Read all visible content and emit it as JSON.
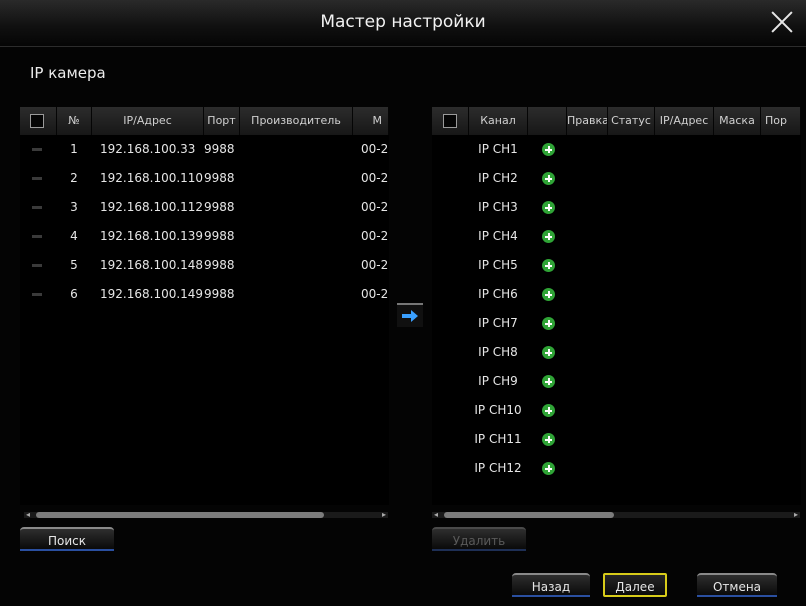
{
  "window": {
    "title": "Мастер настройки"
  },
  "section_title": "IP камера",
  "left_table": {
    "headers": {
      "no": "№",
      "ip": "IP/Адрес",
      "port": "Порт",
      "vendor": "Производитель",
      "mac": "М"
    },
    "rows": [
      {
        "no": "1",
        "ip": "192.168.100.33",
        "port": "9988",
        "mac": "00-2"
      },
      {
        "no": "2",
        "ip": "192.168.100.110",
        "port": "9988",
        "mac": "00-2"
      },
      {
        "no": "3",
        "ip": "192.168.100.112",
        "port": "9988",
        "mac": "00-2"
      },
      {
        "no": "4",
        "ip": "192.168.100.139",
        "port": "9988",
        "mac": "00-2"
      },
      {
        "no": "5",
        "ip": "192.168.100.148",
        "port": "9988",
        "mac": "00-2"
      },
      {
        "no": "6",
        "ip": "192.168.100.149",
        "port": "9988",
        "mac": "00-2"
      }
    ],
    "search_button": "Поиск"
  },
  "right_table": {
    "headers": {
      "channel": "Канал",
      "edit": "Правка",
      "status": "Статус",
      "ip": "IP/Адрес",
      "mask": "Маска",
      "port": "Пор"
    },
    "rows": [
      {
        "channel": "IP CH1",
        "icon": "add-icon"
      },
      {
        "channel": "IP CH2",
        "icon": "add-icon"
      },
      {
        "channel": "IP CH3",
        "icon": "add-icon"
      },
      {
        "channel": "IP CH4",
        "icon": "add-icon"
      },
      {
        "channel": "IP CH5",
        "icon": "add-icon"
      },
      {
        "channel": "IP CH6",
        "icon": "add-icon"
      },
      {
        "channel": "IP CH7",
        "icon": "add-icon"
      },
      {
        "channel": "IP CH8",
        "icon": "add-icon"
      },
      {
        "channel": "IP CH9",
        "icon": "add-icon"
      },
      {
        "channel": "IP CH10",
        "icon": "add-icon"
      },
      {
        "channel": "IP CH11",
        "icon": "add-icon"
      },
      {
        "channel": "IP CH12",
        "icon": "add-icon"
      }
    ],
    "delete_button": "Удалить"
  },
  "footer": {
    "back": "Назад",
    "next": "Далее",
    "cancel": "Отмена"
  },
  "colors": {
    "accent_blue": "#2a4fa0",
    "highlight_yellow": "#d8cc1a",
    "add_green": "#2fa436"
  }
}
